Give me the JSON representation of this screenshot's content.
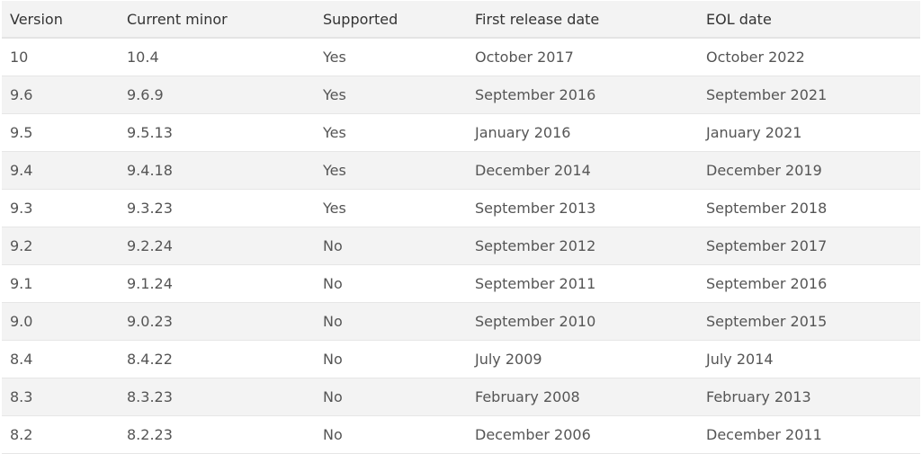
{
  "table": {
    "headers": [
      "Version",
      "Current minor",
      "Supported",
      "First release date",
      "EOL date"
    ],
    "rows": [
      [
        "10",
        "10.4",
        "Yes",
        "October 2017",
        "October 2022"
      ],
      [
        "9.6",
        "9.6.9",
        "Yes",
        "September 2016",
        "September 2021"
      ],
      [
        "9.5",
        "9.5.13",
        "Yes",
        "January 2016",
        "January 2021"
      ],
      [
        "9.4",
        "9.4.18",
        "Yes",
        "December 2014",
        "December 2019"
      ],
      [
        "9.3",
        "9.3.23",
        "Yes",
        "September 2013",
        "September 2018"
      ],
      [
        "9.2",
        "9.2.24",
        "No",
        "September 2012",
        "September 2017"
      ],
      [
        "9.1",
        "9.1.24",
        "No",
        "September 2011",
        "September 2016"
      ],
      [
        "9.0",
        "9.0.23",
        "No",
        "September 2010",
        "September 2015"
      ],
      [
        "8.4",
        "8.4.22",
        "No",
        "July 2009",
        "July 2014"
      ],
      [
        "8.3",
        "8.3.23",
        "No",
        "February 2008",
        "February 2013"
      ],
      [
        "8.2",
        "8.2.23",
        "No",
        "December 2006",
        "December 2011"
      ]
    ]
  }
}
